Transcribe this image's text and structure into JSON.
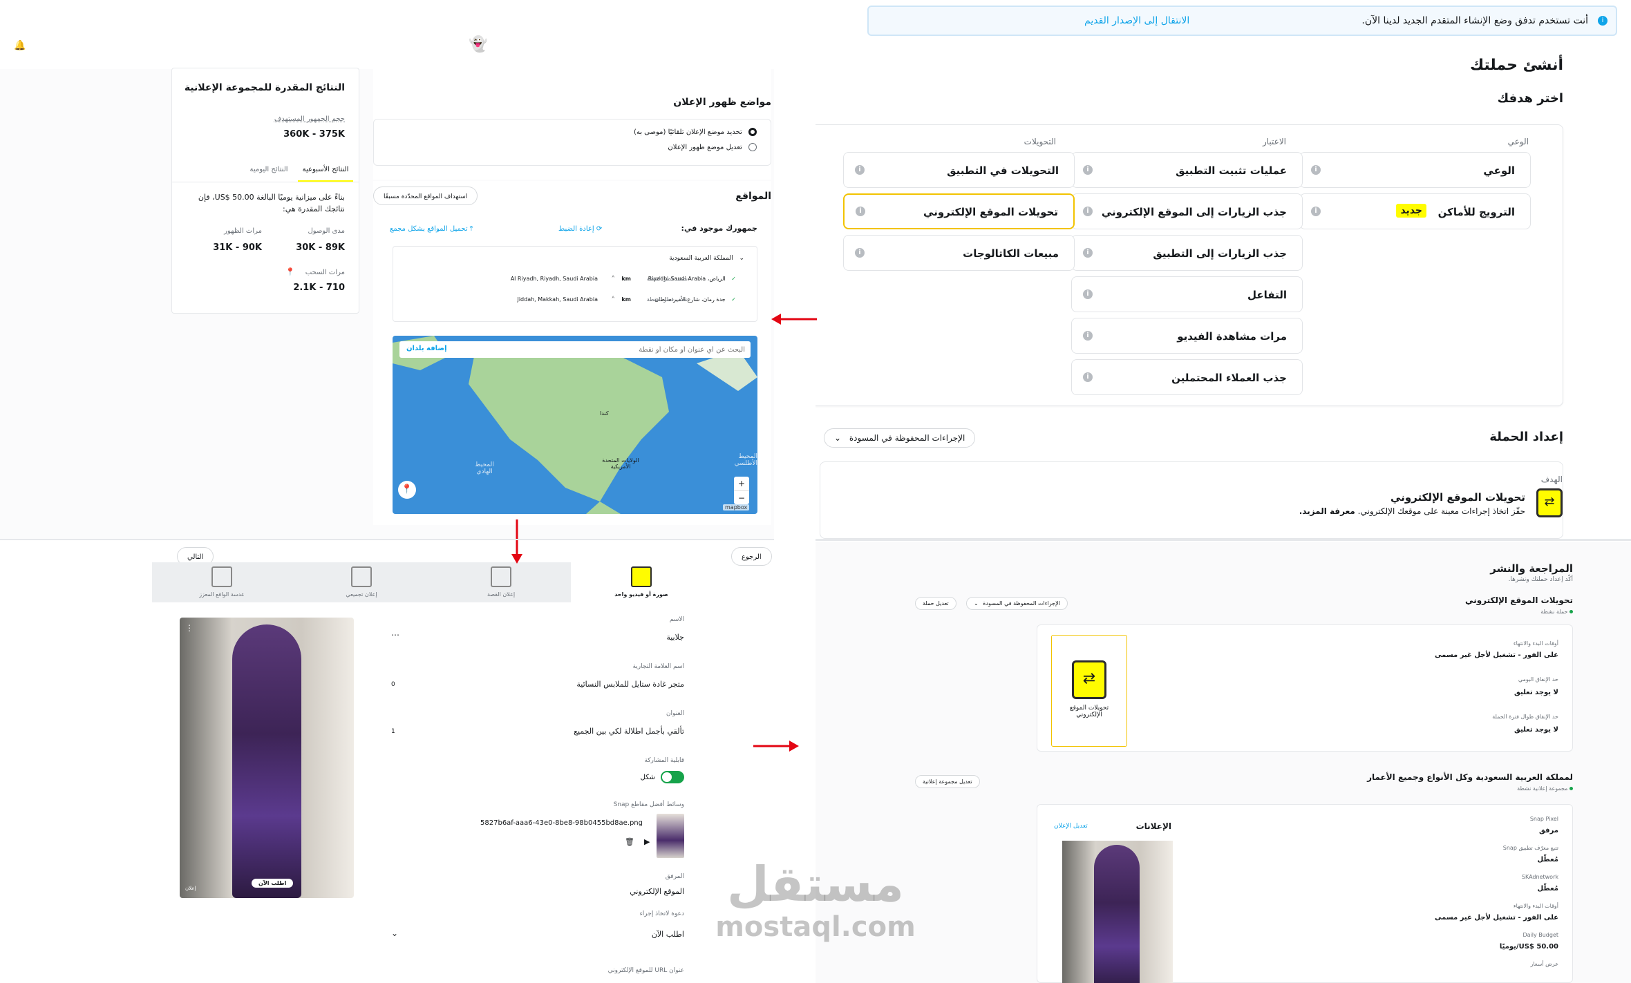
{
  "colors": {
    "accent": "#0fa4e9",
    "brand_yellow": "#fffc00",
    "selected_border": "#f2c300",
    "arrow_red": "#e30613",
    "map_water": "#3a8fd8",
    "map_land": "#a9d39a",
    "success": "#16a34a"
  },
  "tr": {
    "notice_text": "أنت تستخدم تدفق وضع الإنشاء المتقدم الجديد لدينا الآن.",
    "notice_link": "الانتقال إلى الإصدار القديم",
    "create_title": "أنشئ حملتك",
    "choose_goal": "اختر هدفك",
    "col_awareness": "الوعي",
    "col_consideration": "الاعتبار",
    "col_conversions": "التحويلات",
    "awareness": [
      "الوعي",
      "الترويج للأماكن"
    ],
    "new_badge": "جديد",
    "consideration": [
      "عمليات تثبيت التطبيق",
      "جذب الزيارات إلى الموقع الإلكتروني",
      "جذب الزيارات إلى التطبيق",
      "التفاعل",
      "مرات مشاهدة الفيديو",
      "جذب العملاء المحتملين"
    ],
    "conversions": [
      "التحويلات في التطبيق",
      "تحويلات الموقع الإلكتروني",
      "مبيعات الكاتالوجات"
    ],
    "setup_title": "إعداد الحملة",
    "saved_actions": "الإجراءات المحفوظة في المسودة",
    "goal_label": "الهدف",
    "goal_title": "تحويلات الموقع الإلكتروني",
    "goal_desc": "حفّز اتخاذ إجراءات معينة على موقعك الإلكتروني.",
    "learn_more": "معرفة المزيد."
  },
  "tl": {
    "est_title": "النتائج المقدرة للمجموعة الإعلانية",
    "audience_size_label": "حجم الجمهور المستهدف",
    "audience_size": "360K - 375K",
    "tab_weekly": "النتائج الأسبوعية",
    "tab_daily": "النتائج اليومية",
    "budget_text": "بناءً على ميزانية يوميًا البالغة US$ 50.00، فإن نتائجك المقدرة هي:",
    "reach_label": "مدى الوصول",
    "reach": "30K - 89K",
    "impressions_label": "مرات الظهور",
    "impressions": "31K - 90K",
    "swipes_label": "مرات السحب",
    "swipes": "2.1K - 710",
    "placements_title": "مواضع ظهور الإعلان",
    "placement_auto": "تحديد موضع الإعلان تلقائيًا (موصى به)",
    "placement_edit": "تعديل موضع ظهور الإعلان",
    "locations_title": "المواقع",
    "predefined_btn": "استهداف المواقع المحدّدة مسبقًا",
    "audience_in": "جمهورك موجود في:",
    "reset": "إعادة الضبط",
    "bulk_upload": "تحميل المواقع بشكل مجمع",
    "country": "المملكة العربية السعودية",
    "loc1_ar": "الرياض، Riyadh، Saudi Arabia",
    "loc1_en": "Al Riyadh, Riyadh, Saudi Arabia",
    "loc2_ar": "جدة رمان، شارع الأمير سلطان",
    "loc2_en": "Jiddah, Makkah, Saudi Arabia",
    "radius_label": "نصف قطر النقطة",
    "km": "km",
    "map_search_placeholder": "البحث عن أي عنوان أو مكان أو نقطة",
    "add_countries": "إضافة بلدان",
    "map_canada": "كندا",
    "map_usa": "الولايات المتحدة الأمريكية",
    "map_pacific": "المحيط الهادي",
    "map_atlantic": "المحيط الأطلسي",
    "mapbox": "mapbox"
  },
  "bl": {
    "back": "الرجوع",
    "next": "التالي",
    "formats": [
      "صورة أو فيديو واحد",
      "إعلان القصة",
      "إعلان تجميعي",
      "عدسة الواقع المعزز"
    ],
    "name_label": "الاسم",
    "name_value": "جلابية",
    "brand_label": "اسم العلامة التجارية",
    "brand_value": "متجر غادة ستايل للملابس النسائية",
    "brand_count": "0",
    "headline_label": "العنوان",
    "headline_value": "تألقي بأجمل اطلالة لكي بين الجميع",
    "headline_count": "1",
    "share_label": "قابلية المشاركة",
    "share_value": "شكل",
    "media_label": "وسائط أفضل مقاطع Snap",
    "media_file": "5827b6af-aaa6-43e0-8be8-98b0455bd8ae.png",
    "attach_label": "المرفق",
    "attach_value": "الموقع الإلكتروني",
    "cta_label": "دعوة لاتخاذ إجراء",
    "cta_value": "اطلب الآن",
    "url_label": "عنوان URL للموقع الإلكتروني",
    "preview_cta": "اطلب الآن",
    "preview_ad": "إعلان"
  },
  "br": {
    "title": "المراجعة والنشر",
    "subtitle": "أكّد إعداد حملتك ونشرها.",
    "campaign_name": "تحويلات الموقع الإلكتروني",
    "campaign_status": "حملة نشطة",
    "saved_actions": "الإجراءات المحفوظة في المسودة",
    "edit_campaign": "تعديل حملة",
    "card_label": "تحويلات الموقع الإلكتروني",
    "start_end_label": "أوقات البدء والانتهاء",
    "start_end": "على الفور - تشغيل لأجل غير مسمى",
    "daily_cap_label": "حد الإنفاق اليومي",
    "daily_cap": "لا يوجد تعليق",
    "lifetime_cap_label": "حد الإنفاق طوال فترة الحملة",
    "lifetime_cap": "لا يوجد تعليق",
    "adgroup_name": "لمملكة العربية السعودية وكل الأنواع وجميع الأعمار",
    "adgroup_status": "مجموعة إعلانية نشطة",
    "edit_adgroup": "تعديل مجموعة إعلانية",
    "ads_title": "الإعلانات",
    "edit_ad": "تعديل الإعلان",
    "pixel_label": "Snap Pixel",
    "pixel_value": "مرفق",
    "app_track_label": "تتبع معرّف تطبيق Snap",
    "app_track_value": "مُعطّل",
    "skad_label": "SKAdnetwork",
    "skad_value": "مُعطّل",
    "start_end2_label": "أوقات البدء والانتهاء",
    "start_end2": "على الفور - تشغيل لأجل غير مسمى",
    "daily_budget_label": "Daily Budget",
    "daily_budget": "US$ 50.00/يوميًا",
    "bid_label": "عرض أسعار"
  },
  "watermark": {
    "ar": "مستقل",
    "en": "mostaql.com"
  }
}
